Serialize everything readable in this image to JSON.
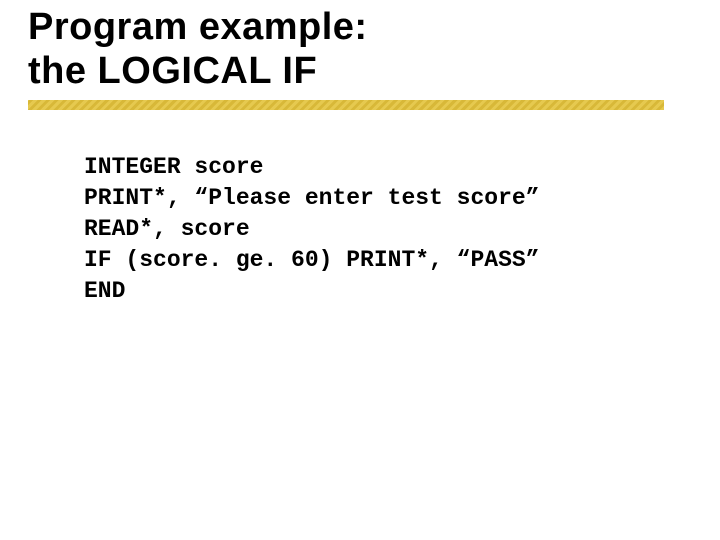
{
  "title": "Program example:\nthe LOGICAL IF",
  "code_lines": [
    "INTEGER score",
    "PRINT*, “Please enter test score”",
    "READ*, score",
    "IF (score. ge. 60) PRINT*, “PASS”",
    "END"
  ]
}
